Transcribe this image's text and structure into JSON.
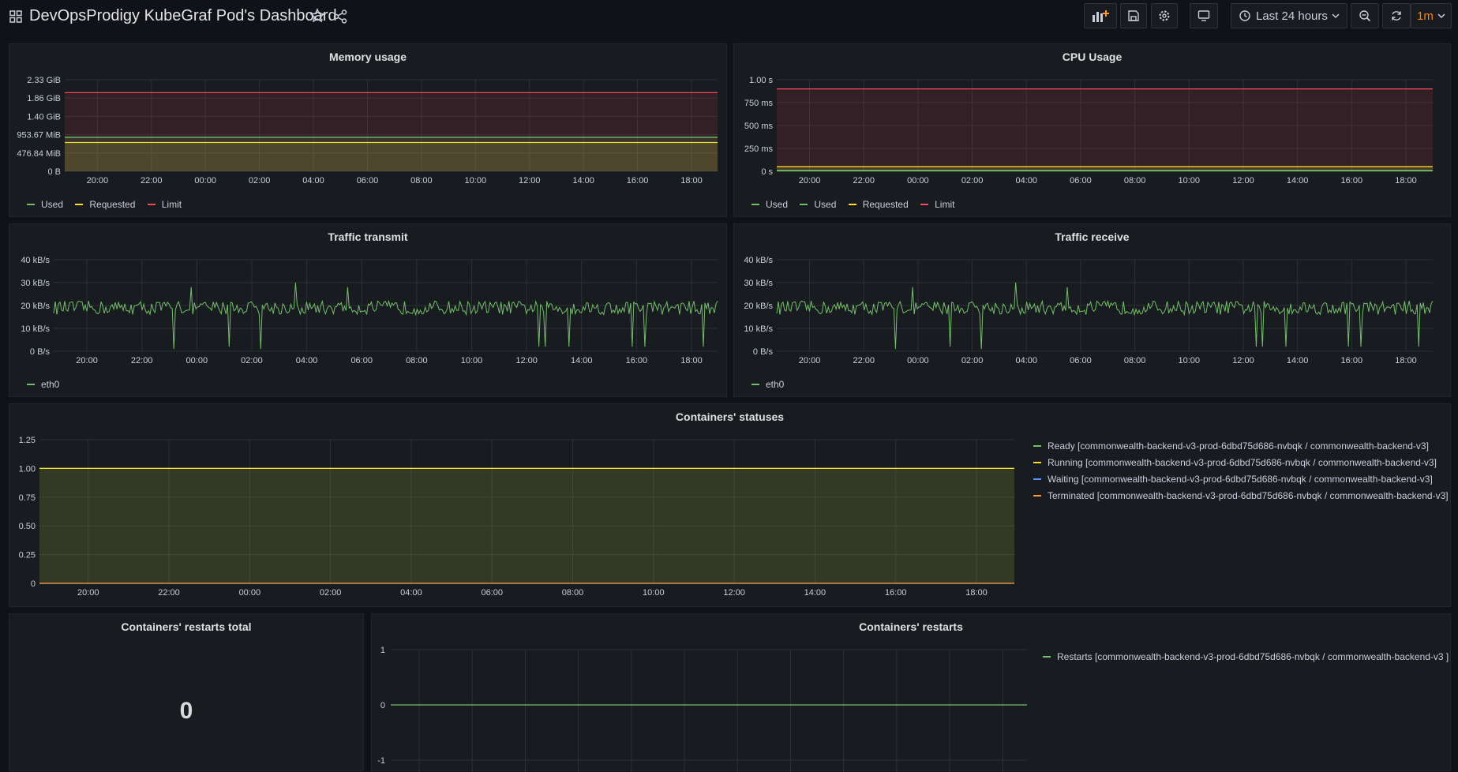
{
  "dashboard": {
    "title": "DevOpsProdigy KubeGraf Pod's Dashboard"
  },
  "toolbar": {
    "add_panel_icon": "bar-chart-plus-icon",
    "time_range": "Last 24 hours",
    "refresh_interval": "1m"
  },
  "colors": {
    "green": "#73bf69",
    "yellow": "#fade2a",
    "red": "#f2495c",
    "orange": "#ff9830",
    "cyan": "#5794f2",
    "accent": "#ff7f00"
  },
  "x_ticks_24h": [
    "20:00",
    "22:00",
    "00:00",
    "02:00",
    "04:00",
    "06:00",
    "08:00",
    "10:00",
    "12:00",
    "14:00",
    "16:00",
    "18:00"
  ],
  "panels": {
    "memory": {
      "title": "Memory usage",
      "y_ticks": [
        "0 B",
        "476.84 MiB",
        "953.67 MiB",
        "1.40 GiB",
        "1.86 GiB",
        "2.33 GiB"
      ],
      "legend": [
        "Used",
        "Requested",
        "Limit"
      ]
    },
    "cpu": {
      "title": "CPU Usage",
      "y_ticks": [
        "0 s",
        "250 ms",
        "500 ms",
        "750 ms",
        "1.00 s"
      ],
      "legend": [
        "Used",
        "Used",
        "Requested",
        "Limit"
      ]
    },
    "tx": {
      "title": "Traffic transmit",
      "y_ticks": [
        "0 B/s",
        "10 kB/s",
        "20 kB/s",
        "30 kB/s",
        "40 kB/s"
      ],
      "legend": [
        "eth0"
      ]
    },
    "rx": {
      "title": "Traffic receive",
      "y_ticks": [
        "0 B/s",
        "10 kB/s",
        "20 kB/s",
        "30 kB/s",
        "40 kB/s"
      ],
      "legend": [
        "eth0"
      ]
    },
    "statuses": {
      "title": "Containers' statuses",
      "y_ticks": [
        "0",
        "0.25",
        "0.50",
        "0.75",
        "1.00",
        "1.25"
      ],
      "legend": [
        "Ready [commonwealth-backend-v3-prod-6dbd75d686-nvbqk / commonwealth-backend-v3]",
        "Running [commonwealth-backend-v3-prod-6dbd75d686-nvbqk / commonwealth-backend-v3]",
        "Waiting [commonwealth-backend-v3-prod-6dbd75d686-nvbqk / commonwealth-backend-v3]",
        "Terminated [commonwealth-backend-v3-prod-6dbd75d686-nvbqk / commonwealth-backend-v3]"
      ]
    },
    "restarts_total": {
      "title": "Containers' restarts total",
      "value": "0"
    },
    "restarts": {
      "title": "Containers' restarts",
      "y_ticks": [
        "-1",
        "0",
        "1"
      ],
      "legend": [
        "Restarts [commonwealth-backend-v3-prod-6dbd75d686-nvbqk / commonwealth-backend-v3 ]"
      ]
    }
  },
  "chart_data": [
    {
      "type": "area",
      "title": "Memory usage",
      "x": [
        "20:00",
        "22:00",
        "00:00",
        "02:00",
        "04:00",
        "06:00",
        "08:00",
        "10:00",
        "12:00",
        "14:00",
        "16:00",
        "18:00"
      ],
      "ylim_mib": [
        0,
        2384
      ],
      "series": [
        {
          "name": "Used",
          "values_mib": [
            885,
            885,
            885,
            885,
            885,
            885,
            885,
            885,
            885,
            885,
            885,
            885
          ]
        },
        {
          "name": "Requested",
          "values_mib": [
            750,
            750,
            750,
            750,
            750,
            750,
            750,
            750,
            750,
            750,
            750,
            750
          ]
        },
        {
          "name": "Limit",
          "values_mib": [
            2048,
            2048,
            2048,
            2048,
            2048,
            2048,
            2048,
            2048,
            2048,
            2048,
            2048,
            2048
          ]
        }
      ]
    },
    {
      "type": "area",
      "title": "CPU Usage",
      "x": [
        "20:00",
        "22:00",
        "00:00",
        "02:00",
        "04:00",
        "06:00",
        "08:00",
        "10:00",
        "12:00",
        "14:00",
        "16:00",
        "18:00"
      ],
      "ylim_ms": [
        0,
        1000
      ],
      "series": [
        {
          "name": "Used",
          "values_ms": [
            10,
            10,
            10,
            10,
            10,
            10,
            10,
            10,
            10,
            10,
            10,
            10
          ]
        },
        {
          "name": "Used",
          "values_ms": [
            5,
            5,
            5,
            5,
            5,
            5,
            5,
            5,
            5,
            5,
            5,
            5
          ]
        },
        {
          "name": "Requested",
          "values_ms": [
            50,
            50,
            50,
            50,
            50,
            50,
            50,
            50,
            50,
            50,
            50,
            50
          ]
        },
        {
          "name": "Limit",
          "values_ms": [
            900,
            900,
            900,
            900,
            900,
            900,
            900,
            900,
            900,
            900,
            900,
            900
          ]
        }
      ]
    },
    {
      "type": "line",
      "title": "Traffic transmit",
      "ylim_kBs": [
        0,
        40
      ],
      "series": [
        {
          "name": "eth0",
          "typical_kBs": 19,
          "spikes_kBs": [
            30,
            29,
            28
          ],
          "drops_kBs": [
            1,
            2,
            0
          ]
        }
      ]
    },
    {
      "type": "line",
      "title": "Traffic receive",
      "ylim_kBs": [
        0,
        40
      ],
      "series": [
        {
          "name": "eth0",
          "typical_kBs": 19,
          "spikes_kBs": [
            30,
            29,
            28
          ],
          "drops_kBs": [
            1,
            2,
            0
          ]
        }
      ]
    },
    {
      "type": "area",
      "title": "Containers' statuses",
      "ylim": [
        0,
        1.25
      ],
      "series": [
        {
          "name": "Ready",
          "value": 1
        },
        {
          "name": "Running",
          "value": 1
        },
        {
          "name": "Waiting",
          "value": 0
        },
        {
          "name": "Terminated",
          "value": 0
        }
      ]
    },
    {
      "type": "line",
      "title": "Containers' restarts",
      "ylim": [
        -1,
        1
      ],
      "series": [
        {
          "name": "Restarts",
          "value": 0
        }
      ]
    }
  ]
}
